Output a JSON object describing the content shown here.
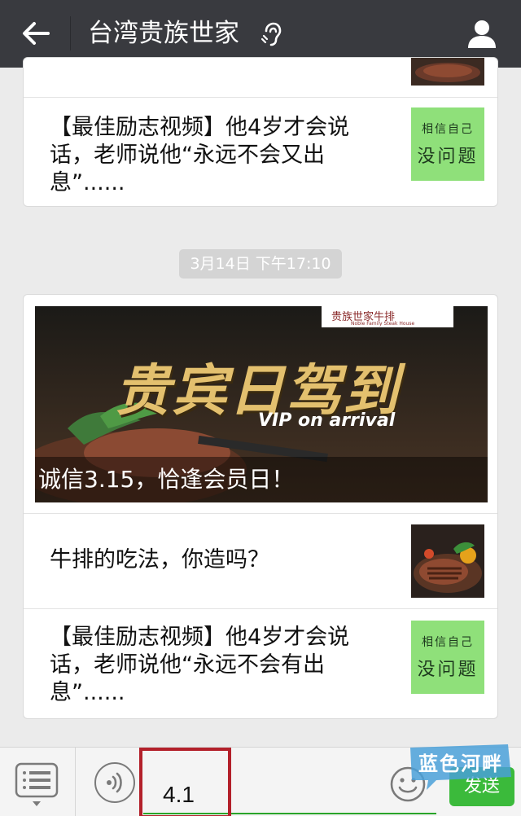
{
  "header": {
    "title": "台湾贵族世家"
  },
  "card1": {
    "items": [
      {
        "text": "【最佳励志视频】他4岁才会说话，老师说他“永远不会又出息”......",
        "thumb_line1": "相信自己",
        "thumb_line2": "没问题"
      }
    ]
  },
  "timestamp": "3月14日 下午17:10",
  "card2": {
    "banner": {
      "brand": "贵族世家牛排",
      "brand_en": "Noble Family Steak House",
      "headline": "贵宾日驾到",
      "subhead": "VIP on arrival",
      "caption": "诚信3.15，恰逢会员日！"
    },
    "items": [
      {
        "text": "牛排的吃法，你造吗？"
      },
      {
        "text": "【最佳励志视频】他4岁才会说话，老师说他“永远不会有出息”......",
        "thumb_line1": "相信自己",
        "thumb_line2": "没问题"
      }
    ]
  },
  "bottom_bar": {
    "input_value": "4.1",
    "send_label": "发送"
  },
  "watermark": {
    "text": "蓝色河畔"
  },
  "colors": {
    "header_bg": "#393a3f",
    "page_bg": "#ebebeb",
    "send_green": "#3bba3b",
    "highlight_red": "#b3202a",
    "thumb_green": "#8fe07a"
  }
}
